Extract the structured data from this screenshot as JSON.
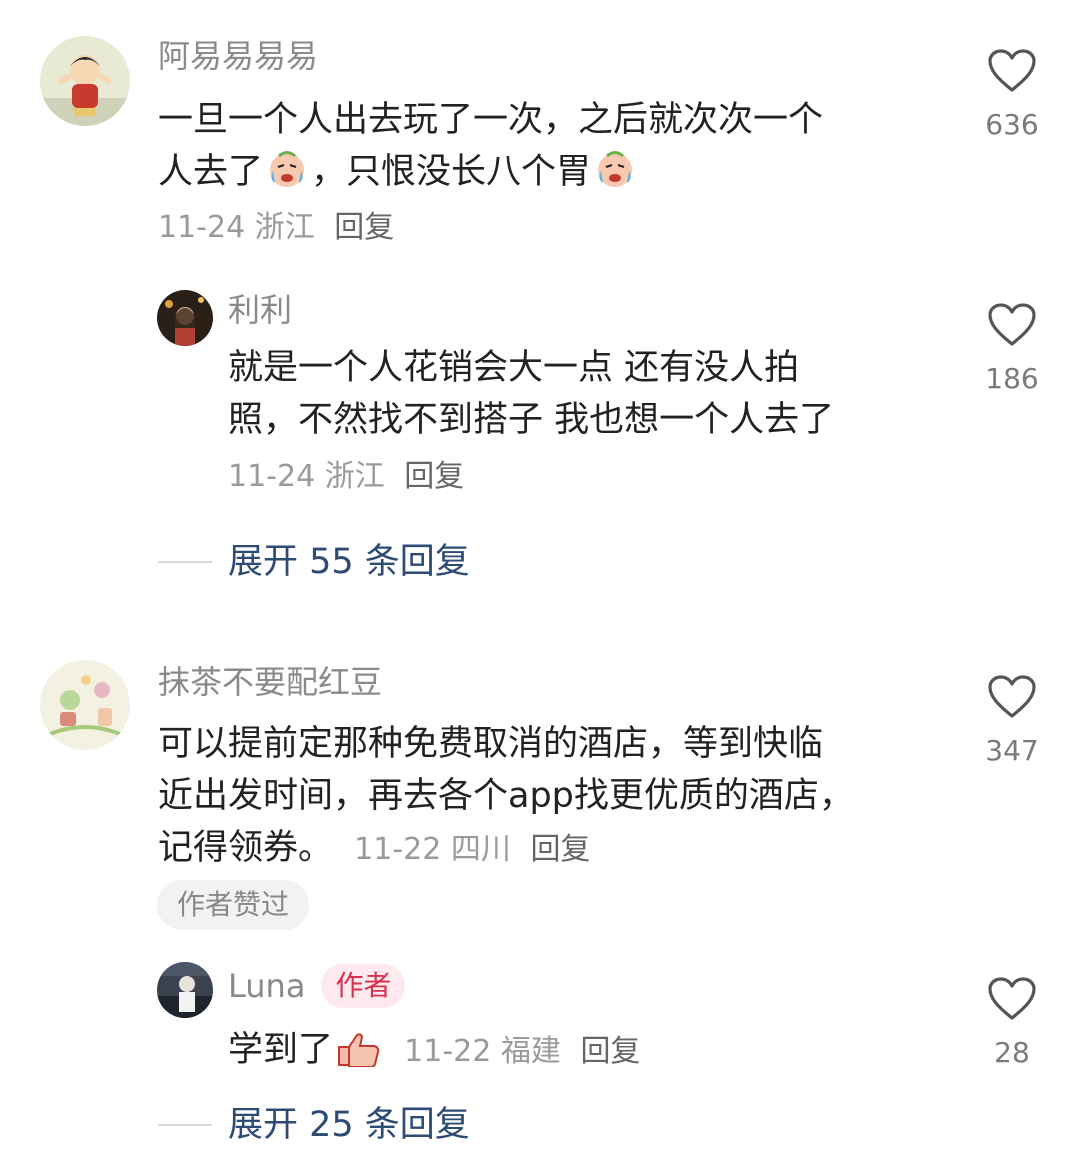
{
  "comments": [
    {
      "username": "阿易易易易",
      "line1": "一旦一个人出去玩了一次，之后就次次一个",
      "line2a": "人去了",
      "line2b": "，只恨没长八个胃",
      "emoji": "crying-face-emoji",
      "date": "11-24",
      "location": "浙江",
      "reply_label": "回复",
      "likes": "636",
      "replies": [
        {
          "username": "利利",
          "line1": "就是一个人花销会大一点 还有没人拍",
          "line2": "照，不然找不到搭子 我也想一个人去了",
          "date": "11-24",
          "location": "浙江",
          "reply_label": "回复",
          "likes": "186"
        }
      ],
      "expand_label": "展开 55 条回复"
    },
    {
      "username": "抹茶不要配红豆",
      "line1": "可以提前定那种免费取消的酒店，等到快临",
      "line2": "近出发时间，再去各个app找更优质的酒店，",
      "line3": "记得领券。",
      "date": "11-22",
      "location": "四川",
      "reply_label": "回复",
      "likes": "347",
      "author_liked_badge": "作者赞过",
      "replies": [
        {
          "username": "Luna",
          "author_badge": "作者",
          "text": "学到了",
          "emoji": "thumbs-up-emoji",
          "date": "11-22",
          "location": "福建",
          "reply_label": "回复",
          "likes": "28"
        }
      ],
      "expand_label": "展开 25 条回复"
    }
  ],
  "icons": {
    "like": "heart-outline-icon"
  },
  "colors": {
    "username": "#8a8a8a",
    "body_text": "#222222",
    "meta": "#9a9a9a",
    "expand_link": "#2e4b76",
    "author_badge_bg": "#fde9ee",
    "author_badge_text": "#d8304f",
    "chip_bg": "#f2f2f2"
  }
}
